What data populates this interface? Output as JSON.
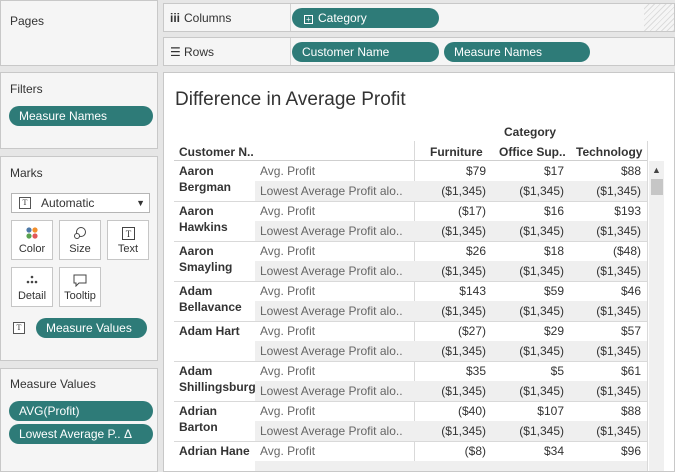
{
  "pages": {
    "title": "Pages"
  },
  "filters": {
    "title": "Filters",
    "pills": [
      "Measure Names"
    ]
  },
  "marks": {
    "title": "Marks",
    "type_selected": "Automatic",
    "buttons": [
      {
        "label": "Color",
        "icon": "color-dots-icon"
      },
      {
        "label": "Size",
        "icon": "size-icon"
      },
      {
        "label": "Text",
        "icon": "text-icon"
      },
      {
        "label": "Detail",
        "icon": "detail-icon"
      },
      {
        "label": "Tooltip",
        "icon": "tooltip-icon"
      }
    ],
    "text_pill": "Measure Values"
  },
  "measure_values": {
    "title": "Measure Values",
    "pills": [
      "AVG(Profit)",
      "Lowest Average P.. Δ"
    ]
  },
  "shelves": {
    "columns_label": "Columns",
    "columns_pills": [
      "Category"
    ],
    "rows_label": "Rows",
    "rows_pills": [
      "Customer Name",
      "Measure Names"
    ]
  },
  "view": {
    "title": "Difference in Average Profit",
    "category_header": "Category",
    "customer_header": "Customer N..",
    "columns": [
      "Furniture",
      "Office Sup..",
      "Technology"
    ],
    "measure_labels": [
      "Avg. Profit",
      "Lowest Average Profit alo.."
    ],
    "rows": [
      {
        "customer": "Aaron Bergman",
        "avg": [
          "$79",
          "$17",
          "$88"
        ],
        "low": [
          "($1,345)",
          "($1,345)",
          "($1,345)"
        ]
      },
      {
        "customer": "Aaron Hawkins",
        "avg": [
          "($17)",
          "$16",
          "$193"
        ],
        "low": [
          "($1,345)",
          "($1,345)",
          "($1,345)"
        ]
      },
      {
        "customer": "Aaron Smayling",
        "avg": [
          "$26",
          "$18",
          "($48)"
        ],
        "low": [
          "($1,345)",
          "($1,345)",
          "($1,345)"
        ]
      },
      {
        "customer": "Adam Bellavance",
        "avg": [
          "$143",
          "$59",
          "$46"
        ],
        "low": [
          "($1,345)",
          "($1,345)",
          "($1,345)"
        ]
      },
      {
        "customer": "Adam Hart",
        "avg": [
          "($27)",
          "$29",
          "$57"
        ],
        "low": [
          "($1,345)",
          "($1,345)",
          "($1,345)"
        ]
      },
      {
        "customer": "Adam Shillingsburg",
        "avg": [
          "$35",
          "$5",
          "$61"
        ],
        "low": [
          "($1,345)",
          "($1,345)",
          "($1,345)"
        ]
      },
      {
        "customer": "Adrian Barton",
        "avg": [
          "($40)",
          "$107",
          "$88"
        ],
        "low": [
          "($1,345)",
          "($1,345)",
          "($1,345)"
        ]
      },
      {
        "customer": "Adrian Hane",
        "avg": [
          "($8)",
          "$34",
          "$96"
        ],
        "low": []
      }
    ]
  },
  "colors": {
    "pill": "#2e7b78",
    "band": "#efefef"
  }
}
